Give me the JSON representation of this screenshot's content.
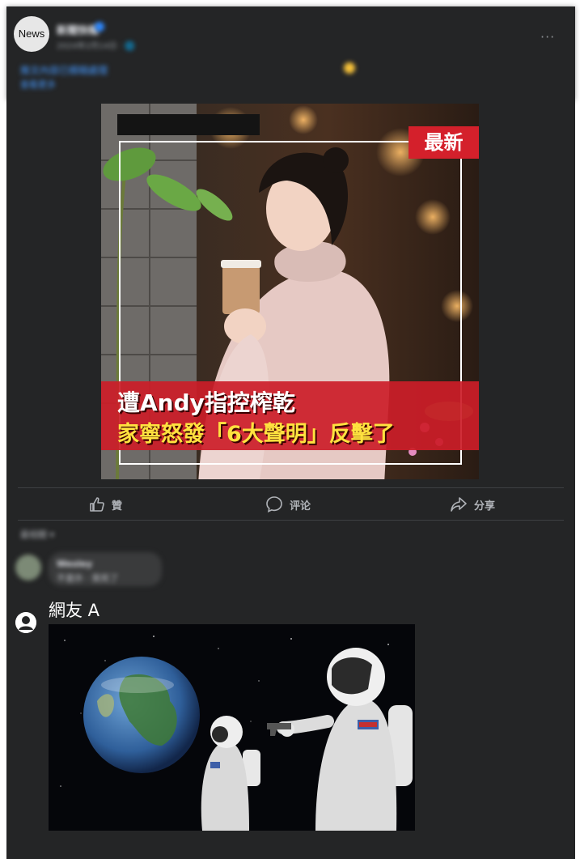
{
  "post": {
    "avatar_text": "News",
    "page_name": "新聞快報",
    "meta": "2024年2月14日 · 🌐",
    "caption": "推文內容已模糊處理",
    "caption_link": "查看更多",
    "more_label": "···"
  },
  "image": {
    "badge": "最新",
    "headline_1": "遭Andy指控榨乾",
    "headline_2": "家寧怒發「6大聲明」反擊了",
    "colors": {
      "badge": "#d4202b",
      "band": "#cc1d28",
      "headline_2": "#ffe23f"
    }
  },
  "actions": {
    "like": "贊",
    "comment": "评论",
    "share": "分享"
  },
  "comments": {
    "sort_label": "最相關 ▾",
    "first": {
      "author": "Wesley",
      "text": "不意外 · 笑死了"
    }
  },
  "reply": {
    "author": "網友 A",
    "meme_icon": "astronaut-meme"
  },
  "theme": {
    "panel": "#242526",
    "divider": "#3e4042",
    "muted_text": "#b0b3b8"
  }
}
